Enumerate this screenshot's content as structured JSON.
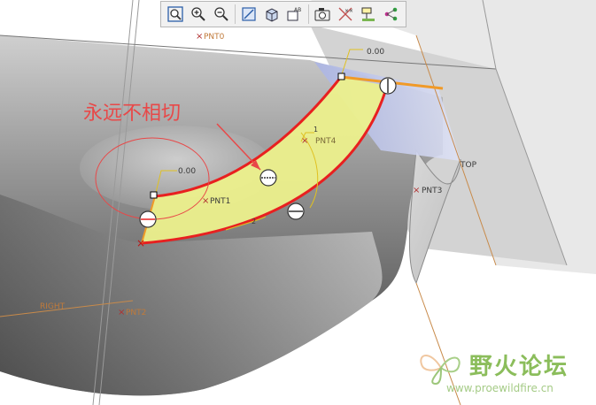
{
  "toolbar": {
    "buttons": [
      {
        "name": "zoom-fit-button",
        "icon": "zoom-fit-icon"
      },
      {
        "name": "zoom-in-button",
        "icon": "zoom-in-icon"
      },
      {
        "name": "zoom-out-button",
        "icon": "zoom-out-icon"
      },
      {
        "name": "repaint-button",
        "icon": "repaint-icon"
      },
      {
        "name": "shading-style-button",
        "icon": "shaded-cube-icon"
      },
      {
        "name": "saved-views-button",
        "icon": "saved-views-icon",
        "label": "AB"
      },
      {
        "name": "screenshot-button",
        "icon": "camera-icon"
      },
      {
        "name": "datum-display-button",
        "icon": "datum-display-icon"
      },
      {
        "name": "annotation-display-button",
        "icon": "annotation-icon"
      },
      {
        "name": "spin-center-button",
        "icon": "spin-center-icon"
      }
    ]
  },
  "datums": {
    "pnt0": "PNT0",
    "pnt4": "PNT4",
    "pnt3": "PNT3",
    "pnt2": "PNT2",
    "pnt1": "PNT1",
    "top": "TOP",
    "right": "RIGHT"
  },
  "dimensions": {
    "upper": "0.00",
    "lower": "0.00",
    "one": "1",
    "two": "2"
  },
  "annotation": {
    "text": "永远不相切"
  },
  "watermark": {
    "title": "野火论坛",
    "url": "www.proewildfire.cn"
  },
  "colors": {
    "surface_highlight": "#ecf08c",
    "edge_red": "#e82020",
    "edge_orange": "#f09a28",
    "datum_label": "#c07a3a",
    "annotation_red": "#e84848",
    "watermark_green": "#7fb64a"
  }
}
